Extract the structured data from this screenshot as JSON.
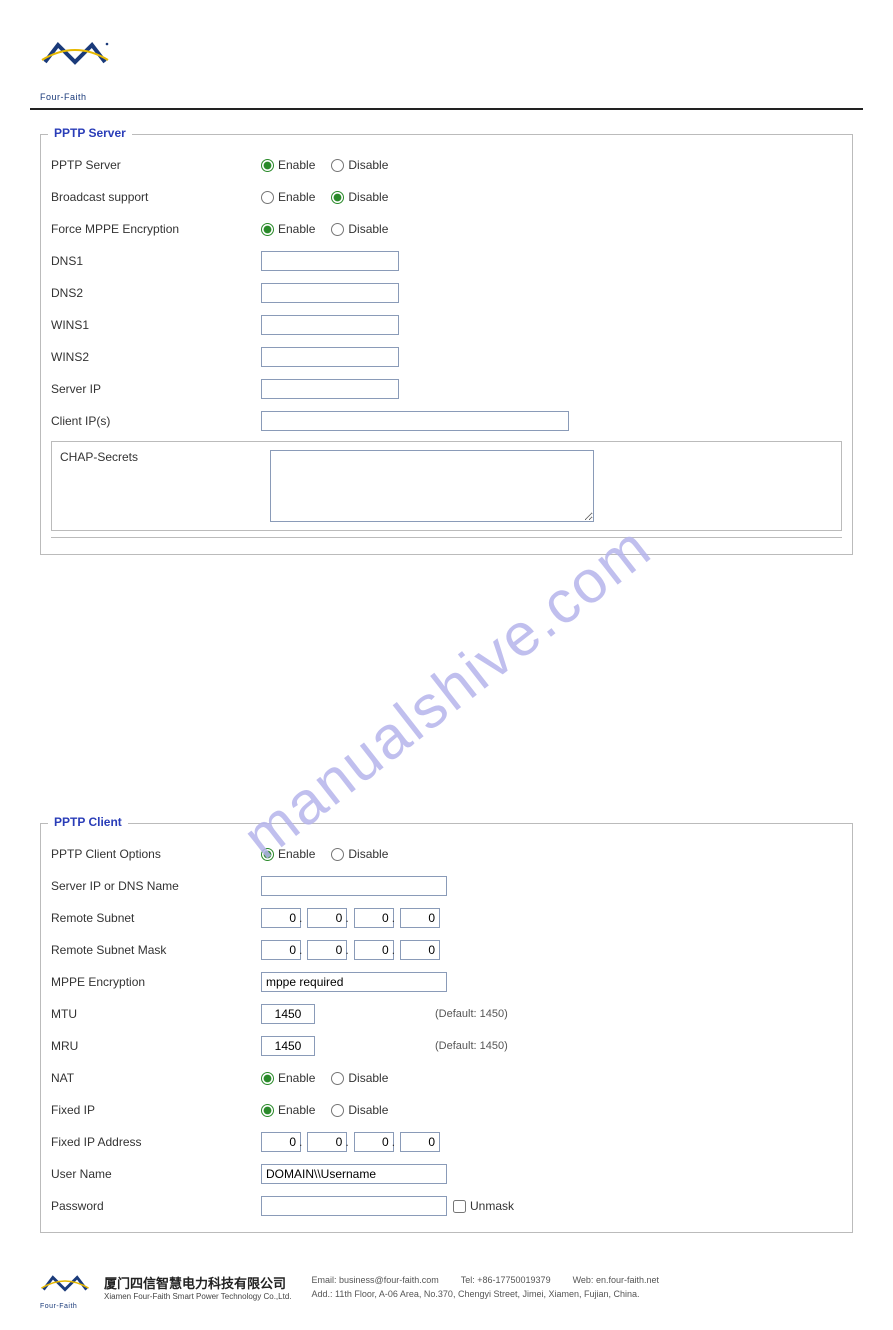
{
  "logo_text": "Four-Faith",
  "server": {
    "title": "PPTP Server",
    "rows": {
      "pptp_server": {
        "label": "PPTP Server",
        "enable": "Enable",
        "disable": "Disable",
        "selected": "enable"
      },
      "broadcast": {
        "label": "Broadcast support",
        "enable": "Enable",
        "disable": "Disable",
        "selected": "disable"
      },
      "mppe": {
        "label": "Force MPPE Encryption",
        "enable": "Enable",
        "disable": "Disable",
        "selected": "enable"
      },
      "dns1": {
        "label": "DNS1",
        "value": ""
      },
      "dns2": {
        "label": "DNS2",
        "value": ""
      },
      "wins1": {
        "label": "WINS1",
        "value": ""
      },
      "wins2": {
        "label": "WINS2",
        "value": ""
      },
      "server_ip": {
        "label": "Server IP",
        "value": ""
      },
      "client_ips": {
        "label": "Client IP(s)",
        "value": ""
      },
      "chap": {
        "label": "CHAP-Secrets",
        "value": ""
      }
    }
  },
  "client": {
    "title": "PPTP Client",
    "rows": {
      "options": {
        "label": "PPTP Client Options",
        "enable": "Enable",
        "disable": "Disable",
        "selected": "enable"
      },
      "server_dns": {
        "label": "Server IP or DNS Name",
        "value": ""
      },
      "remote_subnet": {
        "label": "Remote Subnet",
        "o1": "0",
        "o2": "0",
        "o3": "0",
        "o4": "0"
      },
      "remote_mask": {
        "label": "Remote Subnet Mask",
        "o1": "0",
        "o2": "0",
        "o3": "0",
        "o4": "0"
      },
      "mppe_enc": {
        "label": "MPPE Encryption",
        "value": "mppe required"
      },
      "mtu": {
        "label": "MTU",
        "value": "1450",
        "hint": "(Default: 1450)"
      },
      "mru": {
        "label": "MRU",
        "value": "1450",
        "hint": "(Default: 1450)"
      },
      "nat": {
        "label": "NAT",
        "enable": "Enable",
        "disable": "Disable",
        "selected": "enable"
      },
      "fixedip": {
        "label": "Fixed IP",
        "enable": "Enable",
        "disable": "Disable",
        "selected": "enable"
      },
      "fixedip_addr": {
        "label": "Fixed IP Address",
        "o1": "0",
        "o2": "0",
        "o3": "0",
        "o4": "0"
      },
      "username": {
        "label": "User Name",
        "value": "DOMAIN\\\\Username"
      },
      "password": {
        "label": "Password",
        "value": "",
        "unmask": "Unmask"
      }
    }
  },
  "watermark": "manualshive.com",
  "footer": {
    "company_cn": "厦门四信智慧电力科技有限公司",
    "company_en": "Xiamen Four-Faith Smart Power Technology Co.,Ltd.",
    "email_label": "Email:",
    "email": "business@four-faith.com",
    "tel_label": "Tel:",
    "tel": "+86-17750019379",
    "web_label": "Web:",
    "web": "en.four-faith.net",
    "addr_label": "Add.:",
    "addr": "11th Floor, A-06 Area, No.370, Chengyi Street, Jimei, Xiamen, Fujian, China."
  }
}
